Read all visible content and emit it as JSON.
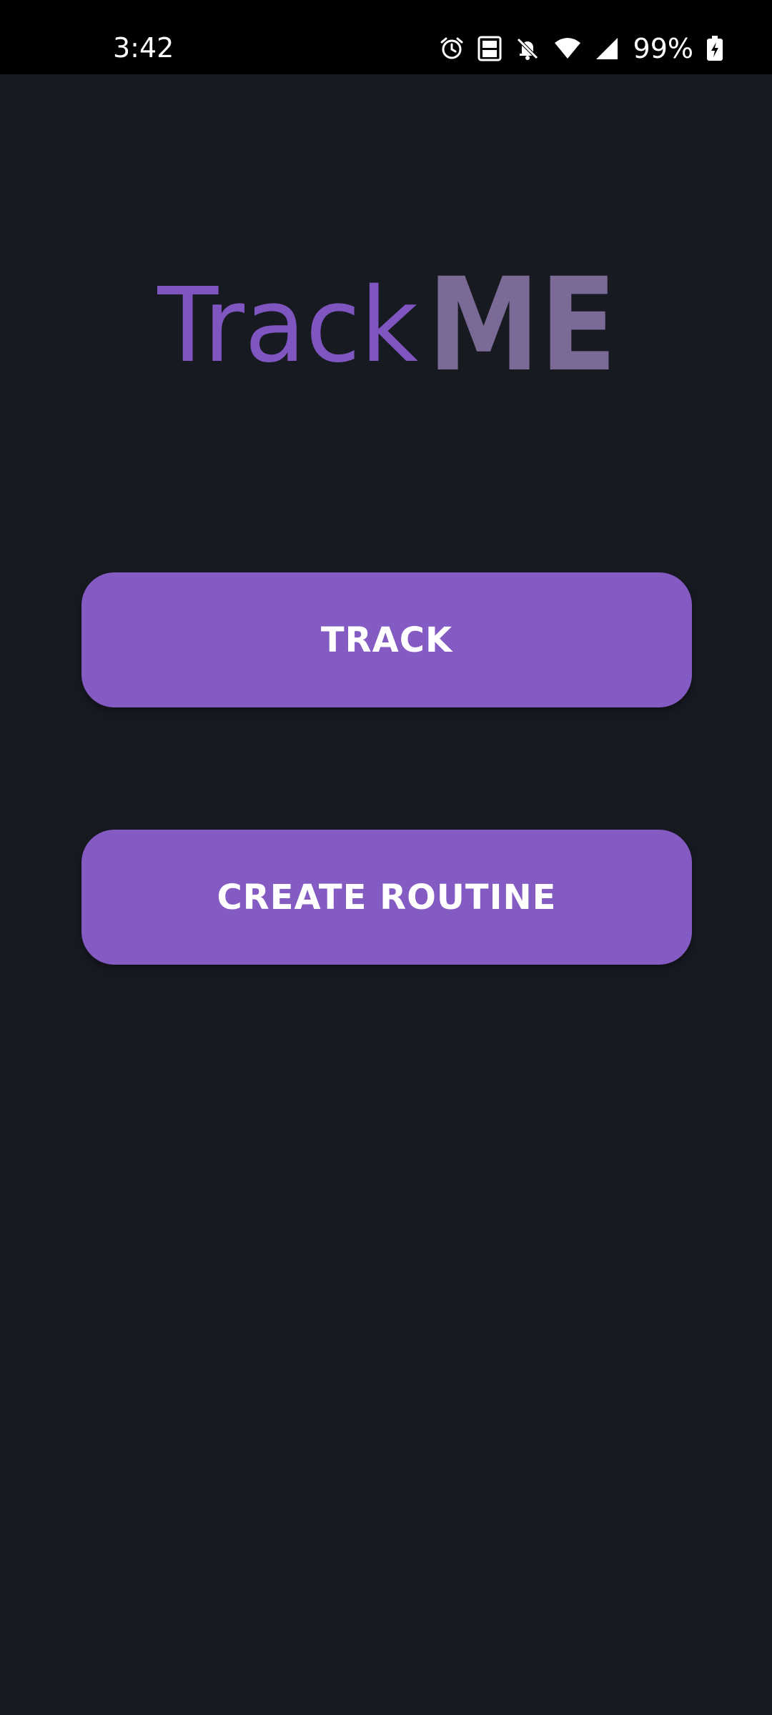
{
  "status_bar": {
    "time": "3:42",
    "battery_percent": "99%",
    "icons": [
      "alarm-icon",
      "volte-icon",
      "bell-off-icon",
      "wifi-icon",
      "signal-icon",
      "battery-charging-icon"
    ]
  },
  "logo": {
    "part1": "Track",
    "part2": "ME",
    "part1_color": "#7f55c0",
    "part2_color": "#7a6a95"
  },
  "buttons": {
    "track_label": "TRACK",
    "create_routine_label": "CREATE ROUTINE"
  },
  "colors": {
    "background": "#181a22",
    "accent": "#845ac3",
    "status_bar": "#000000"
  }
}
